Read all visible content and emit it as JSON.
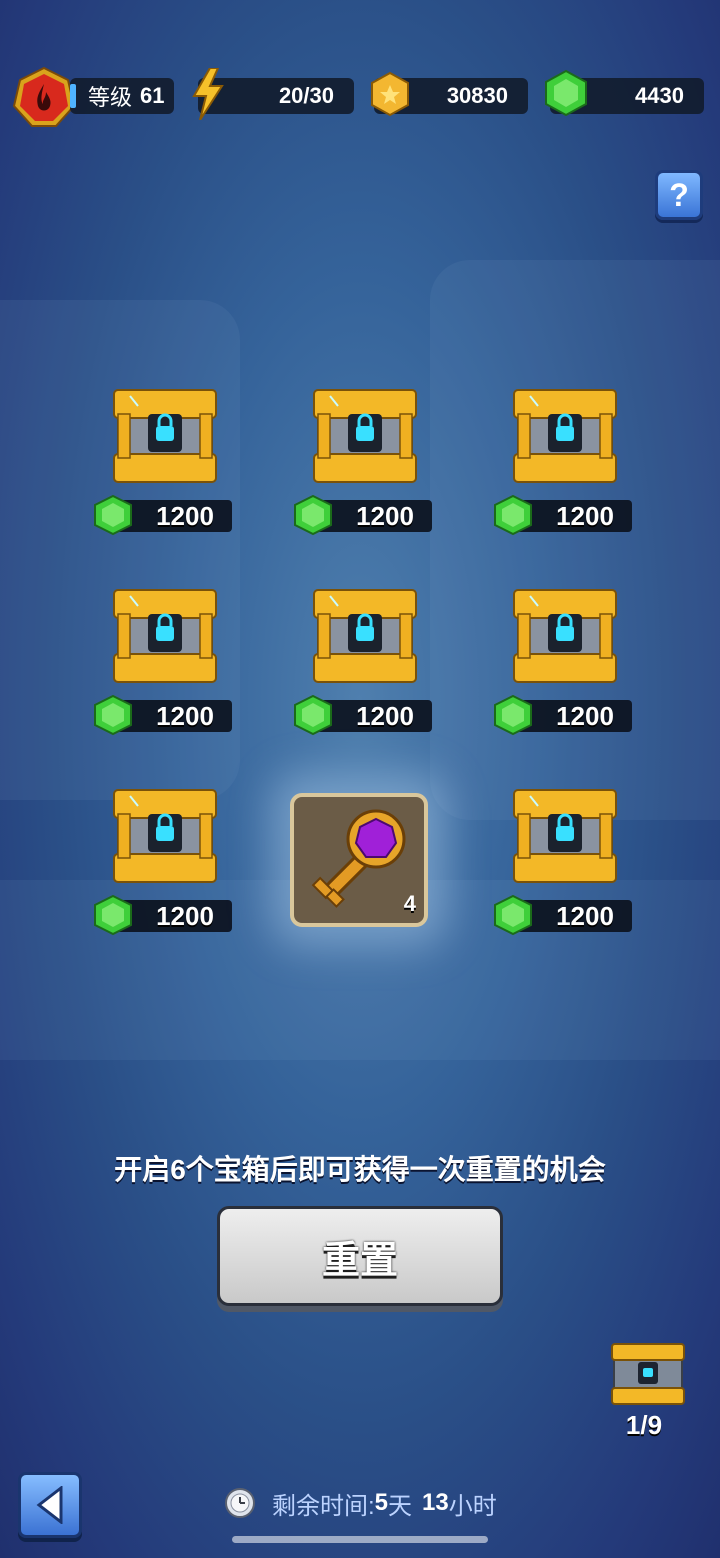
{
  "header": {
    "level_label": "等级",
    "level_value": "61",
    "energy": "20/30",
    "coins": "30830",
    "gems": "4430"
  },
  "help_label": "?",
  "chests": [
    {
      "price": "1200"
    },
    {
      "price": "1200"
    },
    {
      "price": "1200"
    },
    {
      "price": "1200"
    },
    {
      "price": "1200"
    },
    {
      "price": "1200"
    },
    {
      "price": "1200"
    },
    {
      "price": "1200"
    }
  ],
  "key_reward": {
    "count": "4"
  },
  "hint_text": "开启6个宝箱后即可获得一次重置的机会",
  "reset_button_label": "重置",
  "chest_progress": "1/9",
  "timer": {
    "label": "剩余时间:",
    "days_value": "5",
    "days_unit": "天",
    "hours_value": "13",
    "hours_unit": "小时"
  },
  "colors": {
    "background": "#2a4f87",
    "gem": "#3fcf3a",
    "coin": "#f2b533",
    "chest_gold": "#f3b827",
    "lock_glow": "#39e0ff"
  },
  "icons": [
    "level-badge-icon",
    "lightning-icon",
    "coin-icon",
    "gem-icon",
    "help-icon",
    "chest-icon",
    "key-icon",
    "back-arrow-icon",
    "clock-icon"
  ]
}
